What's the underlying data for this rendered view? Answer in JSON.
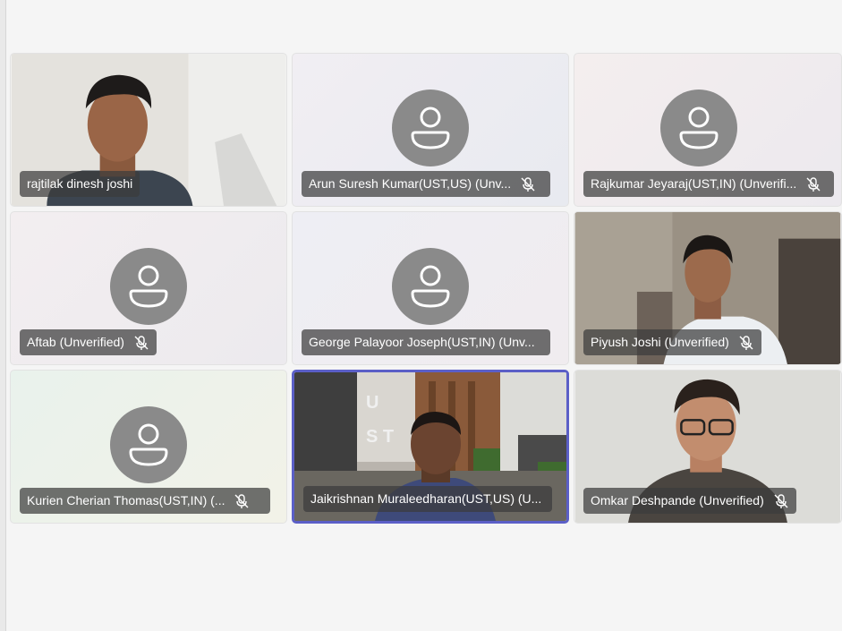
{
  "participants": [
    {
      "name": "rajtilak dinesh joshi",
      "has_video": true,
      "muted": false
    },
    {
      "name": "Arun Suresh Kumar(UST,US) (Unv...",
      "has_video": false,
      "muted": true
    },
    {
      "name": "Rajkumar Jeyaraj(UST,IN) (Unverifi...",
      "has_video": false,
      "muted": true
    },
    {
      "name": "Aftab (Unverified)",
      "has_video": false,
      "muted": true
    },
    {
      "name": "George Palayoor Joseph(UST,IN) (Unv...",
      "has_video": false,
      "muted": false
    },
    {
      "name": "Piyush Joshi (Unverified)",
      "has_video": true,
      "muted": true
    },
    {
      "name": "Kurien Cherian Thomas(UST,IN) (...",
      "has_video": false,
      "muted": true
    },
    {
      "name": "Jaikrishnan Muraleedharan(UST,US) (U...",
      "has_video": true,
      "muted": false,
      "active_speaker": true
    },
    {
      "name": "Omkar Deshpande (Unverified)",
      "has_video": true,
      "muted": true
    }
  ],
  "icons": {
    "avatar": "person-icon",
    "muted": "mic-off-icon"
  },
  "colors": {
    "active_border": "#5b5fc7",
    "avatar_bg": "#8a8a8a",
    "name_tag_bg": "rgba(60,60,60,0.72)"
  }
}
